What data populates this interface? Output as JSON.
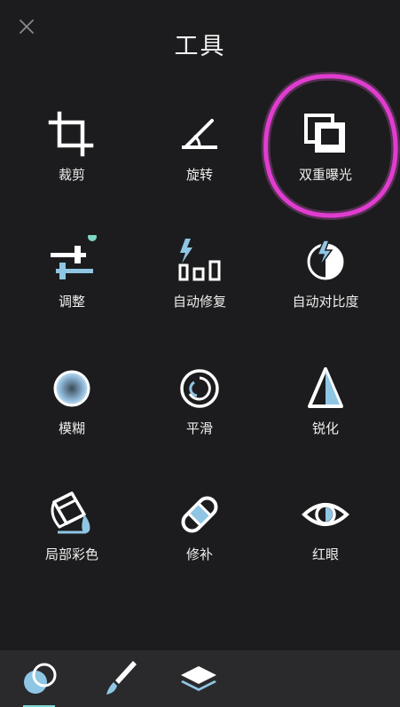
{
  "header": {
    "title": "工具"
  },
  "tools": [
    {
      "label": "裁剪",
      "icon": "crop-icon"
    },
    {
      "label": "旋转",
      "icon": "rotate-icon"
    },
    {
      "label": "双重曝光",
      "icon": "double-exposure-icon"
    },
    {
      "label": "调整",
      "icon": "tune-image-icon"
    },
    {
      "label": "自动修复",
      "icon": "auto-fix-icon"
    },
    {
      "label": "自动对比度",
      "icon": "auto-contrast-icon"
    },
    {
      "label": "模糊",
      "icon": "blur-icon"
    },
    {
      "label": "平滑",
      "icon": "smooth-icon"
    },
    {
      "label": "锐化",
      "icon": "sharpen-icon"
    },
    {
      "label": "局部彩色",
      "icon": "local-color-icon"
    },
    {
      "label": "修补",
      "icon": "heal-bandage-icon"
    },
    {
      "label": "红眼",
      "icon": "red-eye-icon"
    }
  ],
  "bottom_tabs": [
    {
      "name": "tools-tab",
      "icon": "tools-circles-icon",
      "active": true
    },
    {
      "name": "brush-tab",
      "icon": "brush-icon",
      "active": false
    },
    {
      "name": "layers-tab",
      "icon": "layers-icon",
      "active": false
    }
  ],
  "colors": {
    "background": "#1c1c1e",
    "text": "#eeeeee",
    "accent": "#7fd6d6",
    "icon_blue": "#8fc6e4",
    "highlight_stroke": "#e030d0",
    "bottom_bar": "#2a2a2c"
  }
}
